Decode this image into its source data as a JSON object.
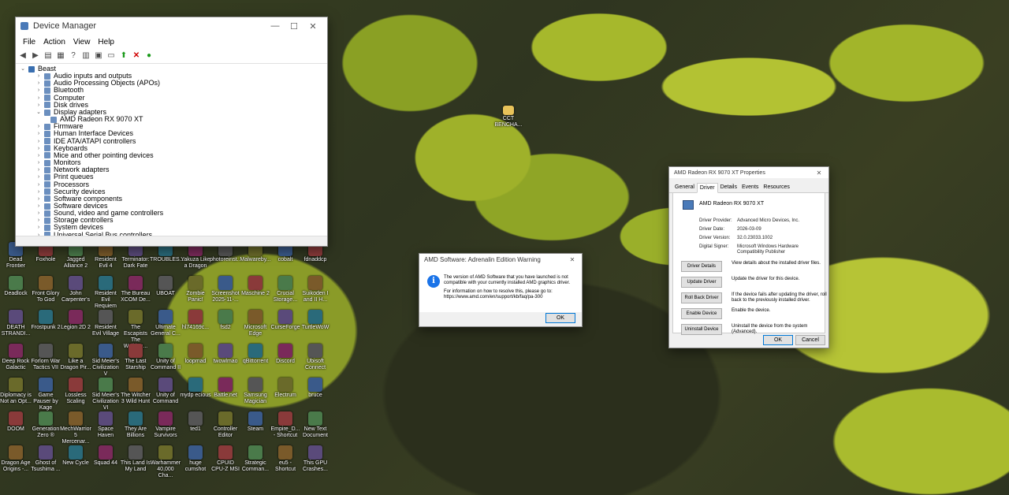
{
  "desktop": {
    "icons": [
      {
        "label": "Dead Frontier",
        "col": 0,
        "row": 0
      },
      {
        "label": "Foxhole",
        "col": 1,
        "row": 0
      },
      {
        "label": "Jagged Alliance 2",
        "col": 2,
        "row": 0
      },
      {
        "label": "Resident Evil 4",
        "col": 3,
        "row": 0
      },
      {
        "label": "Terminator: Dark Fate",
        "col": 4,
        "row": 0
      },
      {
        "label": "TROUBLES...",
        "col": 5,
        "row": 0
      },
      {
        "label": "Yakuza Like a Dragon",
        "col": 6,
        "row": 0
      },
      {
        "label": "photoreinst...",
        "col": 7,
        "row": 0
      },
      {
        "label": "Malwareby...",
        "col": 8,
        "row": 0
      },
      {
        "label": "cobalt",
        "col": 9,
        "row": 0
      },
      {
        "label": "fdnaddcp",
        "col": 10,
        "row": 0
      },
      {
        "label": "Deadlock",
        "col": 0,
        "row": 1
      },
      {
        "label": "Front Glory To God",
        "col": 1,
        "row": 1
      },
      {
        "label": "John Carpenter's",
        "col": 2,
        "row": 1
      },
      {
        "label": "Resident Evil Requiem",
        "col": 3,
        "row": 1
      },
      {
        "label": "The Bureau XCOM De...",
        "col": 4,
        "row": 1
      },
      {
        "label": "UBOAT",
        "col": 5,
        "row": 1
      },
      {
        "label": "Zombie Panic!",
        "col": 6,
        "row": 1
      },
      {
        "label": "Screenshot 2025-11-...",
        "col": 7,
        "row": 1
      },
      {
        "label": "Maschine 2",
        "col": 8,
        "row": 1
      },
      {
        "label": "Crucial Storage...",
        "col": 9,
        "row": 1
      },
      {
        "label": "Suikoden I and II H...",
        "col": 10,
        "row": 1
      },
      {
        "label": "DEATH STRANDI...",
        "col": 0,
        "row": 2
      },
      {
        "label": "Frostpunk 2",
        "col": 1,
        "row": 2
      },
      {
        "label": "Legion 2D 2",
        "col": 2,
        "row": 2
      },
      {
        "label": "Resident Evil Village",
        "col": 3,
        "row": 2
      },
      {
        "label": "The Escapists The Walking...",
        "col": 4,
        "row": 2
      },
      {
        "label": "Ultimate General C...",
        "col": 5,
        "row": 2
      },
      {
        "label": "hl74169c...",
        "col": 6,
        "row": 2
      },
      {
        "label": "fsd2",
        "col": 7,
        "row": 2
      },
      {
        "label": "Microsoft Edge",
        "col": 8,
        "row": 2
      },
      {
        "label": "CurseForge",
        "col": 9,
        "row": 2
      },
      {
        "label": "TurtleWoW",
        "col": 10,
        "row": 2
      },
      {
        "label": "Deep Rock Galactic",
        "col": 0,
        "row": 3
      },
      {
        "label": "Forlorn War Tactics VII",
        "col": 1,
        "row": 3
      },
      {
        "label": "Like a Dragon Pir...",
        "col": 2,
        "row": 3
      },
      {
        "label": "Sid Meier's Civilization V",
        "col": 3,
        "row": 3
      },
      {
        "label": "The Last Starship",
        "col": 4,
        "row": 3
      },
      {
        "label": "Unity of Command II",
        "col": 5,
        "row": 3
      },
      {
        "label": "loopmad",
        "col": 6,
        "row": 3
      },
      {
        "label": "twowlmao",
        "col": 7,
        "row": 3
      },
      {
        "label": "qBittorrent",
        "col": 8,
        "row": 3
      },
      {
        "label": "Discord",
        "col": 9,
        "row": 3
      },
      {
        "label": "Ubisoft Connect",
        "col": 10,
        "row": 3
      },
      {
        "label": "Diplomacy is Not an Opt...",
        "col": 0,
        "row": 4
      },
      {
        "label": "Game Pauser by Kage",
        "col": 1,
        "row": 4
      },
      {
        "label": "Lossless Scaling",
        "col": 2,
        "row": 4
      },
      {
        "label": "Sid Meier's Civilization VI",
        "col": 3,
        "row": 4
      },
      {
        "label": "The Witcher 3 Wild Hunt",
        "col": 4,
        "row": 4
      },
      {
        "label": "Unity of Command",
        "col": 5,
        "row": 4
      },
      {
        "label": "mydp ecious",
        "col": 6,
        "row": 4
      },
      {
        "label": "Battle.net",
        "col": 7,
        "row": 4
      },
      {
        "label": "Samsung Magician",
        "col": 8,
        "row": 4
      },
      {
        "label": "Electrum",
        "col": 9,
        "row": 4
      },
      {
        "label": "bruce",
        "col": 10,
        "row": 4
      },
      {
        "label": "DOOM",
        "col": 0,
        "row": 5
      },
      {
        "label": "Generation Zero ®",
        "col": 1,
        "row": 5
      },
      {
        "label": "MechWarrior 5 Mercenar...",
        "col": 2,
        "row": 5
      },
      {
        "label": "Space Haven",
        "col": 3,
        "row": 5
      },
      {
        "label": "They Are Billions",
        "col": 4,
        "row": 5
      },
      {
        "label": "Vampire Survivors",
        "col": 5,
        "row": 5
      },
      {
        "label": "ted1",
        "col": 6,
        "row": 5
      },
      {
        "label": "Controller Editor",
        "col": 7,
        "row": 5
      },
      {
        "label": "Steam",
        "col": 8,
        "row": 5
      },
      {
        "label": "Empire_D... - Shortcut",
        "col": 9,
        "row": 5
      },
      {
        "label": "New Text Document",
        "col": 10,
        "row": 5
      },
      {
        "label": "Dragon Age Origins -...",
        "col": 0,
        "row": 6
      },
      {
        "label": "Ghost of Tsushima ...",
        "col": 1,
        "row": 6
      },
      {
        "label": "New Cycle",
        "col": 2,
        "row": 6
      },
      {
        "label": "Squad 44",
        "col": 3,
        "row": 6
      },
      {
        "label": "This Land Is My Land",
        "col": 4,
        "row": 6
      },
      {
        "label": "Warhammer 40,000 Cha...",
        "col": 5,
        "row": 6
      },
      {
        "label": "huge cumshot",
        "col": 6,
        "row": 6
      },
      {
        "label": "CPUID CPU-Z MSI",
        "col": 7,
        "row": 6
      },
      {
        "label": "Strategic Comman...",
        "col": 8,
        "row": 6
      },
      {
        "label": "eu5 - Shortcut",
        "col": 9,
        "row": 6
      },
      {
        "label": "This GPU Crashes...",
        "col": 10,
        "row": 6
      }
    ],
    "mid_icon_label": "CCT BENCHA..."
  },
  "device_manager": {
    "title": "Device Manager",
    "window_controls": {
      "minimize": "—",
      "maximize": "☐",
      "close": "✕"
    },
    "menu": [
      "File",
      "Action",
      "View",
      "Help"
    ],
    "tree": {
      "root": "Beast",
      "nodes": [
        {
          "label": "Audio inputs and outputs",
          "expanded": false
        },
        {
          "label": "Audio Processing Objects (APOs)",
          "expanded": false
        },
        {
          "label": "Bluetooth",
          "expanded": false
        },
        {
          "label": "Computer",
          "expanded": false
        },
        {
          "label": "Disk drives",
          "expanded": false
        },
        {
          "label": "Display adapters",
          "expanded": true,
          "children": [
            "AMD Radeon RX 9070 XT"
          ]
        },
        {
          "label": "Firmware",
          "expanded": false
        },
        {
          "label": "Human Interface Devices",
          "expanded": false
        },
        {
          "label": "IDE ATA/ATAPI controllers",
          "expanded": false
        },
        {
          "label": "Keyboards",
          "expanded": false
        },
        {
          "label": "Mice and other pointing devices",
          "expanded": false
        },
        {
          "label": "Monitors",
          "expanded": false
        },
        {
          "label": "Network adapters",
          "expanded": false
        },
        {
          "label": "Print queues",
          "expanded": false
        },
        {
          "label": "Processors",
          "expanded": false
        },
        {
          "label": "Security devices",
          "expanded": false
        },
        {
          "label": "Software components",
          "expanded": false
        },
        {
          "label": "Software devices",
          "expanded": false
        },
        {
          "label": "Sound, video and game controllers",
          "expanded": false
        },
        {
          "label": "Storage controllers",
          "expanded": false
        },
        {
          "label": "System devices",
          "expanded": false
        },
        {
          "label": "Universal Serial Bus controllers",
          "expanded": false
        }
      ]
    }
  },
  "warning_dialog": {
    "title": "AMD Software: Adrenalin Edition Warning",
    "close": "✕",
    "message_line1": "The version of AMD Software that you have launched is not compatible with your currently installed AMD graphics driver.",
    "message_line2": "For information on how to resolve this, please go to:",
    "link": "https://www.amd.com/en/support/kb/faq/pa-300",
    "ok_label": "OK",
    "info_glyph": "i"
  },
  "properties_dialog": {
    "title": "AMD Radeon RX 9070 XT Properties",
    "close": "✕",
    "tabs": [
      "General",
      "Driver",
      "Details",
      "Events",
      "Resources"
    ],
    "active_tab": "Driver",
    "device_name": "AMD Radeon RX 9070 XT",
    "fields": [
      {
        "label": "Driver Provider:",
        "value": "Advanced Micro Devices, Inc."
      },
      {
        "label": "Driver Date:",
        "value": "2026-03-09"
      },
      {
        "label": "Driver Version:",
        "value": "32.0.23033.1002"
      },
      {
        "label": "Digital Signer:",
        "value": "Microsoft Windows Hardware Compatibility Publisher"
      }
    ],
    "actions": [
      {
        "label": "Driver Details",
        "desc": "View details about the installed driver files."
      },
      {
        "label": "Update Driver",
        "desc": "Update the driver for this device."
      },
      {
        "label": "Roll Back Driver",
        "desc": "If the device fails after updating the driver, roll back to the previously installed driver."
      },
      {
        "label": "Enable Device",
        "desc": "Enable the device."
      },
      {
        "label": "Uninstall Device",
        "desc": "Uninstall the device from the system (Advanced)."
      }
    ],
    "ok_label": "OK",
    "cancel_label": "Cancel"
  }
}
